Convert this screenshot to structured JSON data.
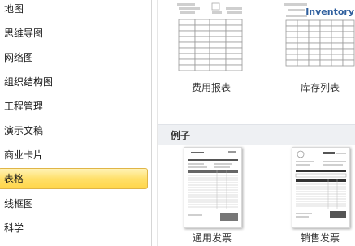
{
  "sidebar": {
    "items": [
      {
        "label": "地图"
      },
      {
        "label": "思维导图"
      },
      {
        "label": "网络图"
      },
      {
        "label": "组织结构图"
      },
      {
        "label": "工程管理"
      },
      {
        "label": "演示文稿"
      },
      {
        "label": "商业卡片"
      },
      {
        "label": "表格",
        "selected": true
      },
      {
        "label": "线框图"
      },
      {
        "label": "科学"
      }
    ]
  },
  "templates": [
    {
      "caption": "费用报表"
    },
    {
      "caption": "库存列表",
      "title_text": "Inventory"
    }
  ],
  "examples_section": {
    "title": "例子",
    "items": [
      {
        "caption": "通用发票"
      },
      {
        "caption": "销售发票"
      }
    ]
  },
  "colors": {
    "accent": "#ffd64a",
    "inventory_title": "#2f5f9e"
  }
}
